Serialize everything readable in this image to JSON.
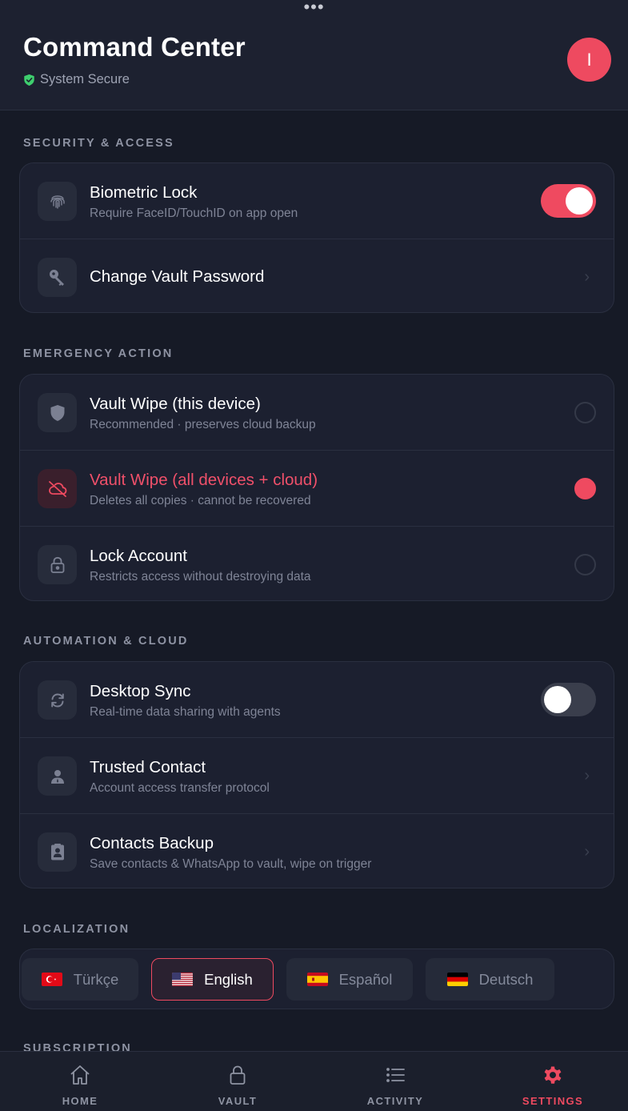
{
  "header": {
    "grabber": "•••",
    "title": "Command Center",
    "status": "System Secure",
    "avatar_initial": "I"
  },
  "sections": {
    "security": {
      "title": "SECURITY & ACCESS",
      "items": [
        {
          "title": "Biometric Lock",
          "subtitle": "Require FaceID/TouchID on app open",
          "icon": "fingerprint-icon",
          "control": "toggle",
          "on": true
        },
        {
          "title": "Change Vault Password",
          "icon": "key-icon",
          "control": "chevron"
        }
      ]
    },
    "emergency": {
      "title": "EMERGENCY ACTION",
      "items": [
        {
          "title": "Vault Wipe (this device)",
          "subtitle": "Recommended · preserves cloud backup",
          "icon": "shield-icon",
          "control": "radio",
          "selected": false
        },
        {
          "title": "Vault Wipe (all devices + cloud)",
          "subtitle": "Deletes all copies · cannot be recovered",
          "icon": "cloud-off-icon",
          "control": "radio",
          "selected": true
        },
        {
          "title": "Lock Account",
          "subtitle": "Restricts access without destroying data",
          "icon": "lock-icon",
          "control": "radio",
          "selected": false
        }
      ]
    },
    "automation": {
      "title": "AUTOMATION & CLOUD",
      "items": [
        {
          "title": "Desktop Sync",
          "subtitle": "Real-time data sharing with agents",
          "icon": "sync-icon",
          "control": "toggle",
          "on": false
        },
        {
          "title": "Trusted Contact",
          "subtitle": "Account access transfer protocol",
          "icon": "person-badge-icon",
          "control": "chevron"
        },
        {
          "title": "Contacts Backup",
          "subtitle": "Save contacts & WhatsApp to vault, wipe on trigger",
          "icon": "contact-card-icon",
          "control": "chevron"
        }
      ]
    },
    "localization": {
      "title": "LOCALIZATION",
      "languages": [
        {
          "label": "Türkçe",
          "flag": "turkey-flag-icon",
          "active": false
        },
        {
          "label": "English",
          "flag": "us-flag-icon",
          "active": true
        },
        {
          "label": "Español",
          "flag": "spain-flag-icon",
          "active": false
        },
        {
          "label": "Deutsch",
          "flag": "germany-flag-icon",
          "active": false
        }
      ]
    },
    "subscription": {
      "title": "SUBSCRIPTION"
    }
  },
  "tabbar": {
    "tabs": [
      {
        "label": "HOME",
        "icon": "home-icon"
      },
      {
        "label": "VAULT",
        "icon": "lock-icon"
      },
      {
        "label": "ACTIVITY",
        "icon": "list-icon"
      },
      {
        "label": "SETTINGS",
        "icon": "gear-icon",
        "active": true
      }
    ]
  },
  "colors": {
    "accent": "#ef4a60",
    "background": "#161a26",
    "card": "#1c2030",
    "secure_green": "#3ecf6e"
  }
}
